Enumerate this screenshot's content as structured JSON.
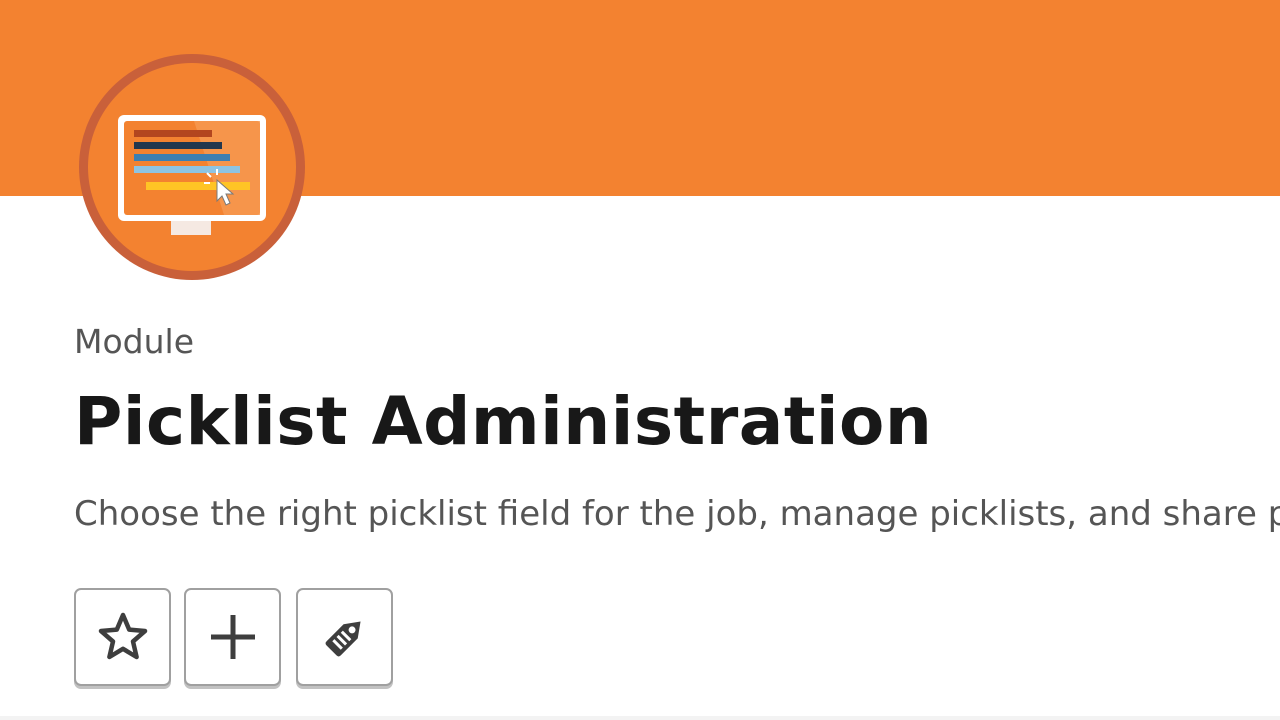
{
  "header": {
    "banner_color": "#F38230",
    "badge_ring_color": "#C9603A",
    "badge_fill_color": "#F38230",
    "badge_icon": "monitor-picklist-icon"
  },
  "module": {
    "type_label": "Module",
    "title": "Picklist Administration",
    "description": "Choose the right picklist field for the job, manage picklists, and share p"
  },
  "actions": [
    {
      "icon": "star-icon",
      "name": "favorite-button"
    },
    {
      "icon": "plus-icon",
      "name": "add-to-collection-button"
    },
    {
      "icon": "tag-icon",
      "name": "tag-button"
    }
  ],
  "colors": {
    "title_text": "#181818",
    "secondary_text": "#555555",
    "button_border": "#A0A0A0",
    "icon": "#3E3E3E"
  }
}
